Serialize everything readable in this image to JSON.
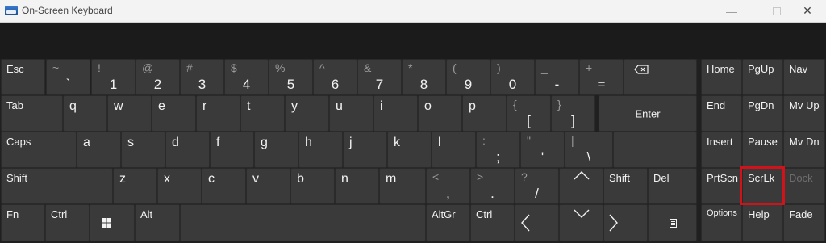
{
  "window": {
    "title": "On-Screen Keyboard",
    "minimize": "—",
    "maximize": "",
    "close": "✕"
  },
  "keys": {
    "esc": "Esc",
    "tilde": {
      "top": "~",
      "main": "`"
    },
    "k1": {
      "top": "!",
      "main": "1"
    },
    "k2": {
      "top": "@",
      "main": "2"
    },
    "k3": {
      "top": "#",
      "main": "3"
    },
    "k4": {
      "top": "$",
      "main": "4"
    },
    "k5": {
      "top": "%",
      "main": "5"
    },
    "k6": {
      "top": "^",
      "main": "6"
    },
    "k7": {
      "top": "&",
      "main": "7"
    },
    "k8": {
      "top": "*",
      "main": "8"
    },
    "k9": {
      "top": "(",
      "main": "9"
    },
    "k0": {
      "top": ")",
      "main": "0"
    },
    "minus": {
      "top": "_",
      "main": "-"
    },
    "equals": {
      "top": "+",
      "main": "="
    },
    "tab": "Tab",
    "q": "q",
    "w": "w",
    "e": "e",
    "r": "r",
    "t": "t",
    "y": "y",
    "u": "u",
    "i": "i",
    "o": "o",
    "p": "p",
    "lbracket": {
      "top": "{",
      "main": "["
    },
    "rbracket": {
      "top": "}",
      "main": "]"
    },
    "enter": "Enter",
    "caps": "Caps",
    "a": "a",
    "s": "s",
    "d": "d",
    "f": "f",
    "g": "g",
    "h": "h",
    "j": "j",
    "k": "k",
    "l": "l",
    "semicolon": {
      "top": ":",
      "main": ";"
    },
    "quote": {
      "top": "\"",
      "main": "'"
    },
    "backslash": {
      "top": "|",
      "main": "\\"
    },
    "shift_left": "Shift",
    "z": "z",
    "x": "x",
    "c": "c",
    "v": "v",
    "b": "b",
    "n": "n",
    "m": "m",
    "comma": {
      "top": "<",
      "main": ","
    },
    "period": {
      "top": ">",
      "main": "."
    },
    "slash": {
      "top": "?",
      "main": "/"
    },
    "shift_right": "Shift",
    "del": "Del",
    "fn": "Fn",
    "ctrl_left": "Ctrl",
    "alt": "Alt",
    "altgr": "AltGr",
    "ctrl_right": "Ctrl",
    "home": "Home",
    "pgup": "PgUp",
    "nav": "Nav",
    "end": "End",
    "pgdn": "PgDn",
    "mvup": "Mv Up",
    "insert": "Insert",
    "pause": "Pause",
    "mvdn": "Mv Dn",
    "prtscn": "PrtScn",
    "scrlk": "ScrLk",
    "dock": "Dock",
    "options": "Options",
    "help": "Help",
    "fade": "Fade"
  },
  "icons": {
    "backspace": "backspace-icon",
    "windows": "windows-logo-icon",
    "up": "arrow-up-icon",
    "down": "arrow-down-icon",
    "left": "arrow-left-icon",
    "right": "arrow-right-icon",
    "menu": "context-menu-icon"
  },
  "colors": {
    "key_bg": "#3a3a3a",
    "background": "#202020",
    "highlight": "#d0121b"
  }
}
